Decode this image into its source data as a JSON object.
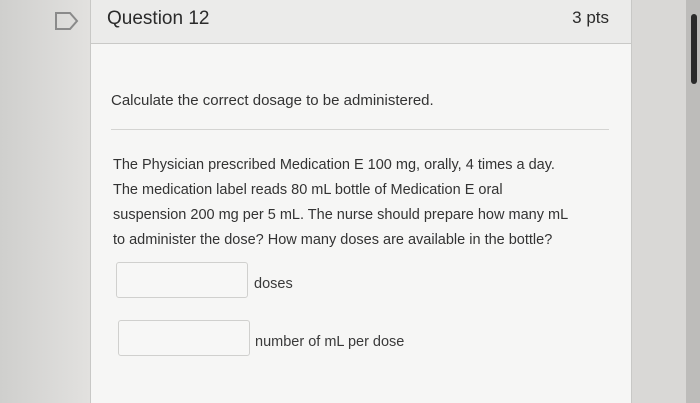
{
  "question": {
    "title": "Question 12",
    "points": "3 pts",
    "prompt": "Calculate the correct dosage to be administered.",
    "body_lines": [
      "The Physician prescribed Medication E 100 mg, orally, 4 times a day.",
      "The medication label reads 80 mL bottle of Medication E oral",
      "suspension 200 mg per 5 mL. The nurse should prepare how many mL",
      "to administer the dose? How many doses are available in the bottle?"
    ],
    "answers": [
      {
        "value": "",
        "label": "doses"
      },
      {
        "value": "",
        "label": "number of mL per dose"
      }
    ]
  },
  "colors": {
    "card_bg": "#f6f6f5",
    "header_bg": "#ebebea",
    "flag_outline": "#8a8a8a"
  },
  "icons": {
    "flag": "flag-outline-icon"
  }
}
